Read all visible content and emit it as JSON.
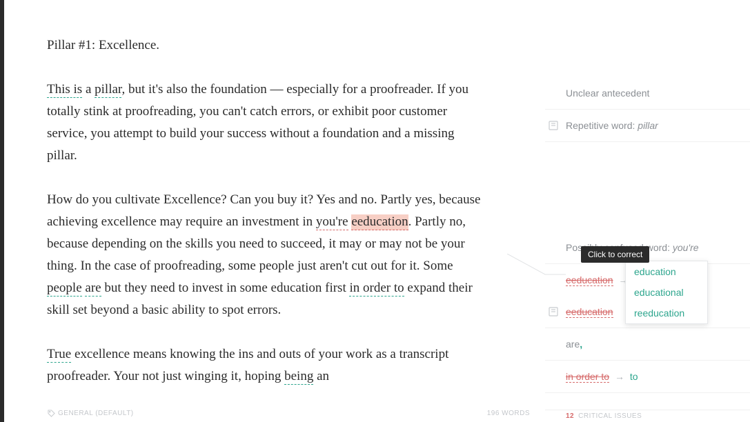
{
  "editor": {
    "heading": "Pillar #1: Excellence.",
    "p1": {
      "t1": "This is",
      "t2": " a ",
      "t3": "pillar",
      "t4": ", but it's also the foundation — especially for a proofreader. If you totally stink at proofreading, you can't catch errors, or exhibit poor customer service, you attempt to build your success without a foundation and a missing pillar."
    },
    "p2": {
      "t1": "How do you cultivate Excellence? Can you buy it? Yes and no. Partly yes, because achieving excellence may require an investment in ",
      "t2": "you're",
      "t3": " ",
      "t4": "eeducation",
      "t5": ". Partly no, because depending on the skills you need to succeed, it may or may not be your thing. In the case of proofreading, some people just aren't cut out for it. Some ",
      "t6": "people",
      "t7": " ",
      "t8": "are",
      "t9": " but they need to invest in some education first ",
      "t10": "in order to",
      "t11": " expand their skill set beyond a basic ability to spot errors."
    },
    "p3": {
      "t1": "True",
      "t2": " excellence means knowing the ins and outs of your work as a transcript proofreader. Your not just winging it, hoping ",
      "t3": "being",
      "t4": " an"
    }
  },
  "sidebar": {
    "item1": {
      "text": "Unclear antecedent"
    },
    "item2": {
      "label": "Repetitive word: ",
      "word": "pillar"
    },
    "item3": {
      "label": "Possibly confused word: ",
      "word": "you're"
    },
    "item4": {
      "wrong": "eeducation",
      "arrow": "→",
      "right": "education"
    },
    "item5": {
      "wrong": "eeducation"
    },
    "item6": {
      "word": "are",
      "comma": ","
    },
    "item7": {
      "wrong": "in order to",
      "arrow": "→",
      "right": "to"
    }
  },
  "suggestions": {
    "opt1": "education",
    "opt2": "educational",
    "opt3": "reeducation"
  },
  "tooltip": "Click to correct",
  "status": {
    "left": "GENERAL (DEFAULT)",
    "right": "196 WORDS"
  },
  "issues": {
    "count": "12",
    "label": "CRITICAL ISSUES"
  }
}
